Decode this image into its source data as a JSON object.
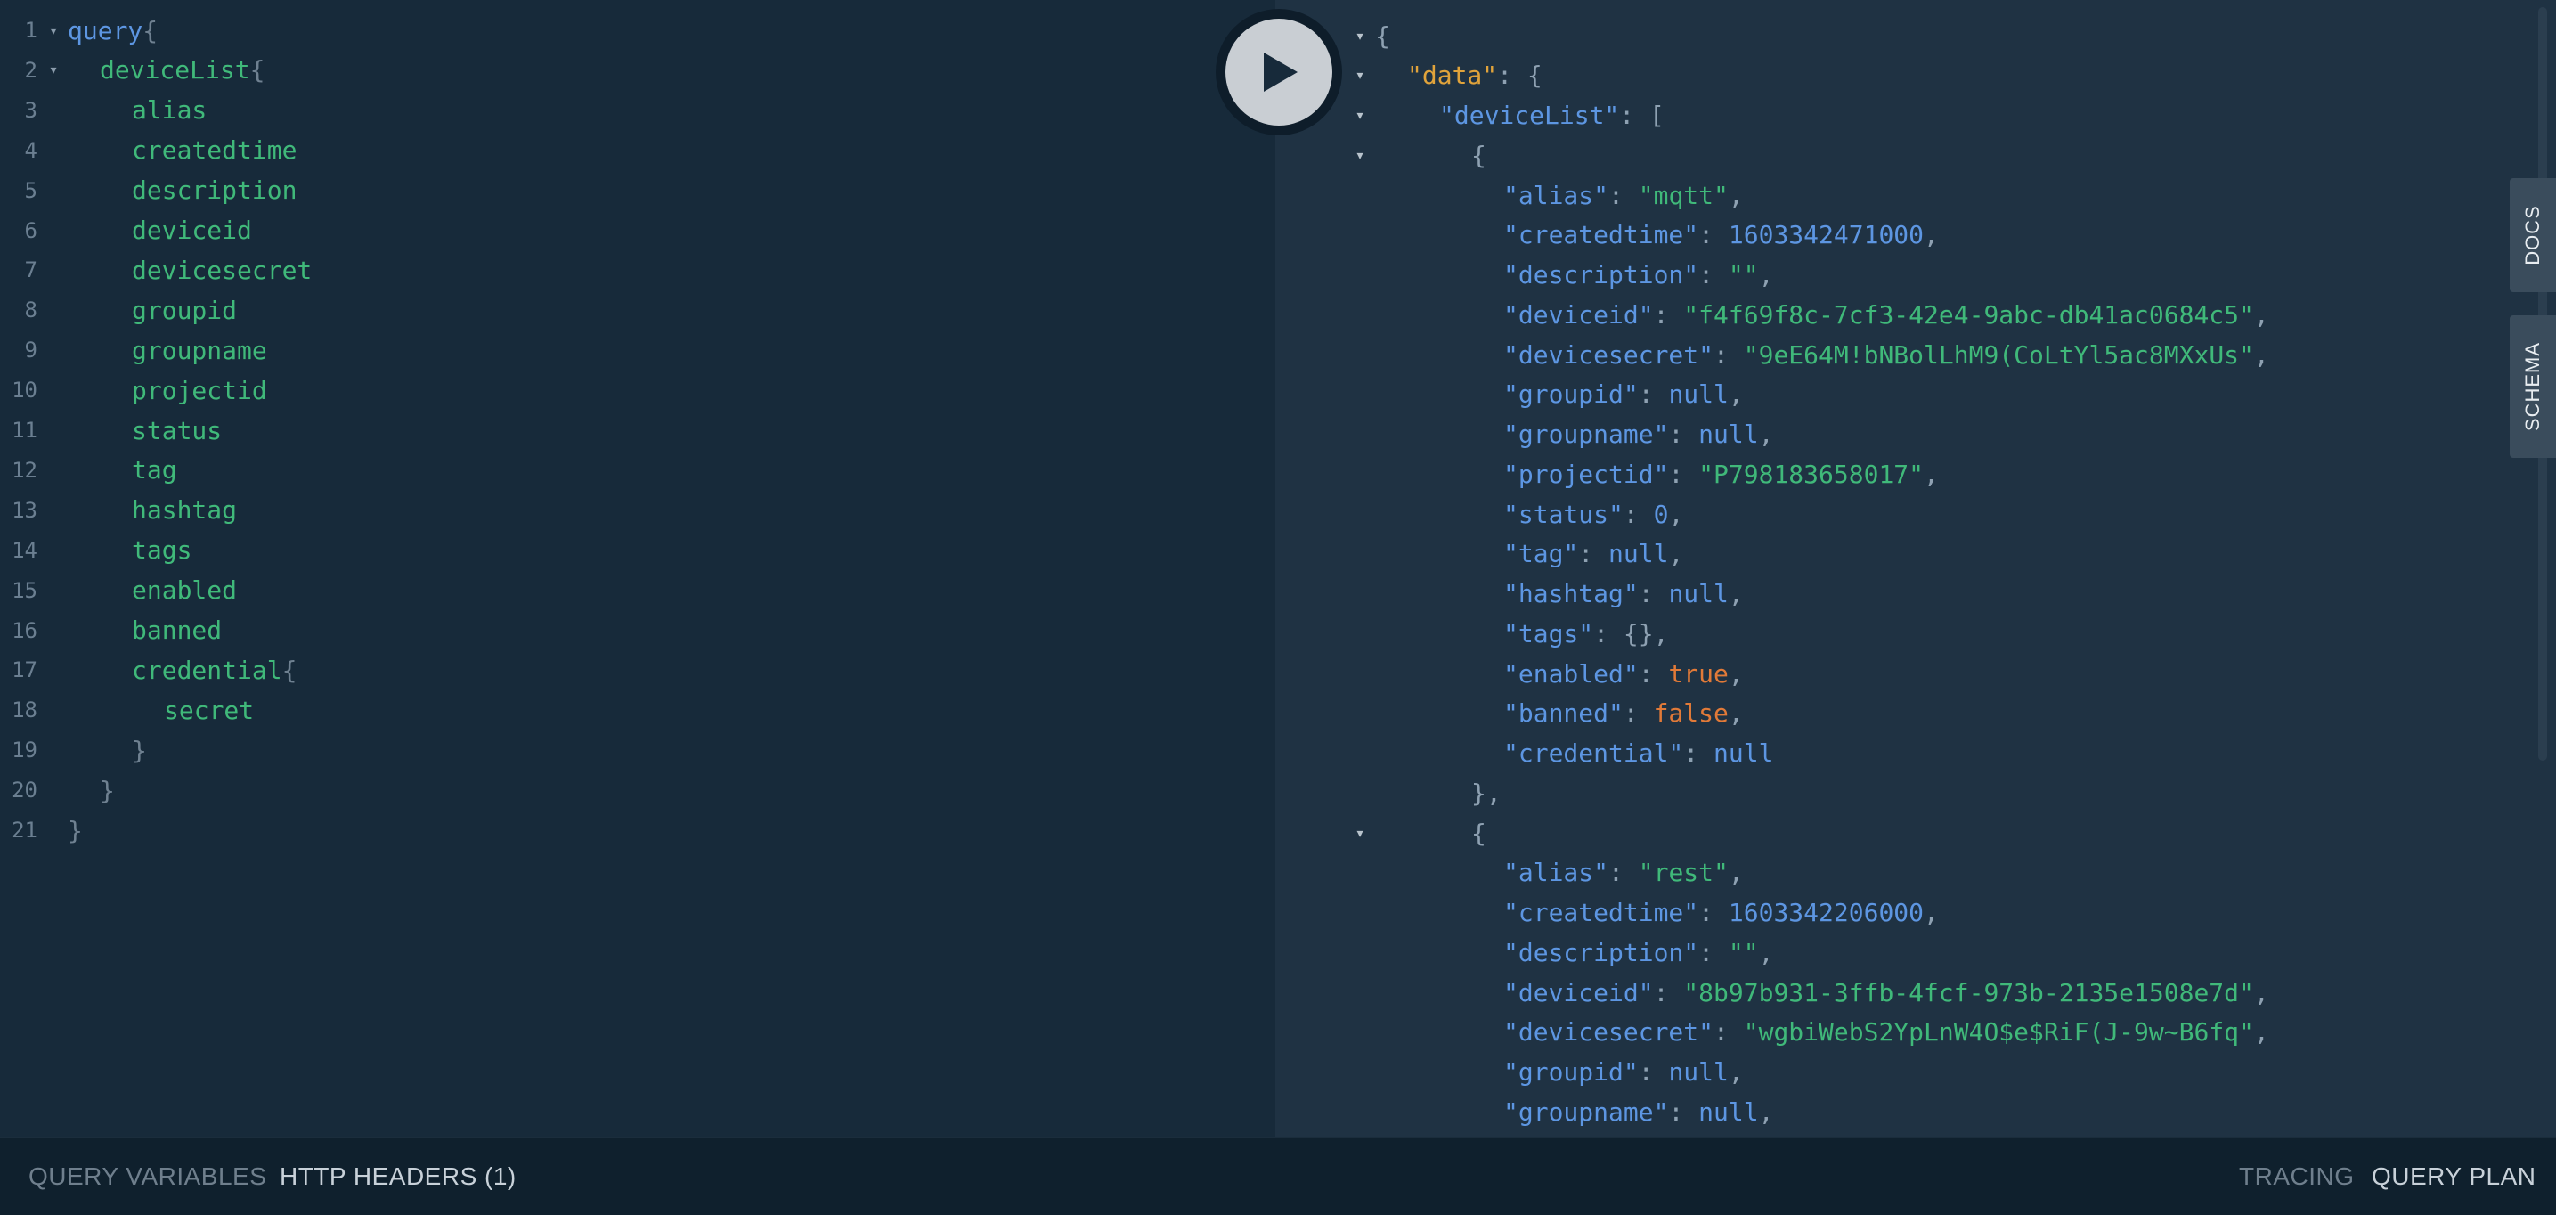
{
  "editor": {
    "lines": [
      {
        "num": "1",
        "fold": "▾",
        "indent": 0,
        "text": "query",
        "cls": "kw",
        "suffix": "{"
      },
      {
        "num": "2",
        "fold": "▾",
        "indent": 1,
        "text": "deviceList",
        "cls": "fld",
        "suffix": "{"
      },
      {
        "num": "3",
        "fold": "",
        "indent": 2,
        "text": "alias",
        "cls": "fld",
        "suffix": ""
      },
      {
        "num": "4",
        "fold": "",
        "indent": 2,
        "text": "createdtime",
        "cls": "fld",
        "suffix": ""
      },
      {
        "num": "5",
        "fold": "",
        "indent": 2,
        "text": "description",
        "cls": "fld",
        "suffix": ""
      },
      {
        "num": "6",
        "fold": "",
        "indent": 2,
        "text": "deviceid",
        "cls": "fld",
        "suffix": ""
      },
      {
        "num": "7",
        "fold": "",
        "indent": 2,
        "text": "devicesecret",
        "cls": "fld",
        "suffix": ""
      },
      {
        "num": "8",
        "fold": "",
        "indent": 2,
        "text": "groupid",
        "cls": "fld",
        "suffix": ""
      },
      {
        "num": "9",
        "fold": "",
        "indent": 2,
        "text": "groupname",
        "cls": "fld",
        "suffix": ""
      },
      {
        "num": "10",
        "fold": "",
        "indent": 2,
        "text": "projectid",
        "cls": "fld",
        "suffix": ""
      },
      {
        "num": "11",
        "fold": "",
        "indent": 2,
        "text": "status",
        "cls": "fld",
        "suffix": ""
      },
      {
        "num": "12",
        "fold": "",
        "indent": 2,
        "text": "tag",
        "cls": "fld",
        "suffix": ""
      },
      {
        "num": "13",
        "fold": "",
        "indent": 2,
        "text": "hashtag",
        "cls": "fld",
        "suffix": ""
      },
      {
        "num": "14",
        "fold": "",
        "indent": 2,
        "text": "tags",
        "cls": "fld",
        "suffix": ""
      },
      {
        "num": "15",
        "fold": "",
        "indent": 2,
        "text": "enabled",
        "cls": "fld",
        "suffix": ""
      },
      {
        "num": "16",
        "fold": "",
        "indent": 2,
        "text": "banned",
        "cls": "fld",
        "suffix": ""
      },
      {
        "num": "17",
        "fold": "",
        "indent": 2,
        "text": "credential",
        "cls": "fld",
        "suffix": "{"
      },
      {
        "num": "18",
        "fold": "",
        "indent": 3,
        "text": "secret",
        "cls": "fld",
        "suffix": ""
      },
      {
        "num": "19",
        "fold": "",
        "indent": 2,
        "text": "",
        "cls": "br",
        "suffix": "}"
      },
      {
        "num": "20",
        "fold": "",
        "indent": 1,
        "text": "",
        "cls": "br",
        "suffix": "}"
      },
      {
        "num": "21",
        "fold": "",
        "indent": 0,
        "text": "",
        "cls": "br",
        "suffix": "}"
      }
    ]
  },
  "play_button_label": "Run query",
  "result": {
    "lines": [
      {
        "fold": "▾",
        "indent": 0,
        "parts": [
          [
            "p",
            "{"
          ]
        ]
      },
      {
        "fold": "▾",
        "indent": 1,
        "parts": [
          [
            "k-data",
            "\"data\""
          ],
          [
            "p",
            ": {"
          ]
        ]
      },
      {
        "fold": "▾",
        "indent": 2,
        "parts": [
          [
            "k",
            "\"deviceList\""
          ],
          [
            "p",
            ": ["
          ]
        ]
      },
      {
        "fold": "▾",
        "indent": 3,
        "parts": [
          [
            "p",
            "{"
          ]
        ]
      },
      {
        "fold": "",
        "indent": 4,
        "parts": [
          [
            "k",
            "\"alias\""
          ],
          [
            "p",
            ": "
          ],
          [
            "s",
            "\"mqtt\""
          ],
          [
            "p",
            ","
          ]
        ]
      },
      {
        "fold": "",
        "indent": 4,
        "parts": [
          [
            "k",
            "\"createdtime\""
          ],
          [
            "p",
            ": "
          ],
          [
            "n",
            "1603342471000"
          ],
          [
            "p",
            ","
          ]
        ]
      },
      {
        "fold": "",
        "indent": 4,
        "parts": [
          [
            "k",
            "\"description\""
          ],
          [
            "p",
            ": "
          ],
          [
            "s",
            "\"\""
          ],
          [
            "p",
            ","
          ]
        ]
      },
      {
        "fold": "",
        "indent": 4,
        "parts": [
          [
            "k",
            "\"deviceid\""
          ],
          [
            "p",
            ": "
          ],
          [
            "s",
            "\"f4f69f8c-7cf3-42e4-9abc-db41ac0684c5\""
          ],
          [
            "p",
            ","
          ]
        ]
      },
      {
        "fold": "",
        "indent": 4,
        "parts": [
          [
            "k",
            "\"devicesecret\""
          ],
          [
            "p",
            ": "
          ],
          [
            "s",
            "\"9eE64M!bNBolLhM9(CoLtYl5ac8MXxUs\""
          ],
          [
            "p",
            ","
          ]
        ]
      },
      {
        "fold": "",
        "indent": 4,
        "parts": [
          [
            "k",
            "\"groupid\""
          ],
          [
            "p",
            ": "
          ],
          [
            "nul",
            "null"
          ],
          [
            "p",
            ","
          ]
        ]
      },
      {
        "fold": "",
        "indent": 4,
        "parts": [
          [
            "k",
            "\"groupname\""
          ],
          [
            "p",
            ": "
          ],
          [
            "nul",
            "null"
          ],
          [
            "p",
            ","
          ]
        ]
      },
      {
        "fold": "",
        "indent": 4,
        "parts": [
          [
            "k",
            "\"projectid\""
          ],
          [
            "p",
            ": "
          ],
          [
            "s",
            "\"P798183658017\""
          ],
          [
            "p",
            ","
          ]
        ]
      },
      {
        "fold": "",
        "indent": 4,
        "parts": [
          [
            "k",
            "\"status\""
          ],
          [
            "p",
            ": "
          ],
          [
            "n",
            "0"
          ],
          [
            "p",
            ","
          ]
        ]
      },
      {
        "fold": "",
        "indent": 4,
        "parts": [
          [
            "k",
            "\"tag\""
          ],
          [
            "p",
            ": "
          ],
          [
            "nul",
            "null"
          ],
          [
            "p",
            ","
          ]
        ]
      },
      {
        "fold": "",
        "indent": 4,
        "parts": [
          [
            "k",
            "\"hashtag\""
          ],
          [
            "p",
            ": "
          ],
          [
            "nul",
            "null"
          ],
          [
            "p",
            ","
          ]
        ]
      },
      {
        "fold": "",
        "indent": 4,
        "parts": [
          [
            "k",
            "\"tags\""
          ],
          [
            "p",
            ": {},"
          ]
        ]
      },
      {
        "fold": "",
        "indent": 4,
        "parts": [
          [
            "k",
            "\"enabled\""
          ],
          [
            "p",
            ": "
          ],
          [
            "bool",
            "true"
          ],
          [
            "p",
            ","
          ]
        ]
      },
      {
        "fold": "",
        "indent": 4,
        "parts": [
          [
            "k",
            "\"banned\""
          ],
          [
            "p",
            ": "
          ],
          [
            "bool",
            "false"
          ],
          [
            "p",
            ","
          ]
        ]
      },
      {
        "fold": "",
        "indent": 4,
        "parts": [
          [
            "k",
            "\"credential\""
          ],
          [
            "p",
            ": "
          ],
          [
            "nul",
            "null"
          ]
        ]
      },
      {
        "fold": "",
        "indent": 3,
        "parts": [
          [
            "p",
            "},"
          ]
        ]
      },
      {
        "fold": "▾",
        "indent": 3,
        "parts": [
          [
            "p",
            "{"
          ]
        ]
      },
      {
        "fold": "",
        "indent": 4,
        "parts": [
          [
            "k",
            "\"alias\""
          ],
          [
            "p",
            ": "
          ],
          [
            "s",
            "\"rest\""
          ],
          [
            "p",
            ","
          ]
        ]
      },
      {
        "fold": "",
        "indent": 4,
        "parts": [
          [
            "k",
            "\"createdtime\""
          ],
          [
            "p",
            ": "
          ],
          [
            "n",
            "1603342206000"
          ],
          [
            "p",
            ","
          ]
        ]
      },
      {
        "fold": "",
        "indent": 4,
        "parts": [
          [
            "k",
            "\"description\""
          ],
          [
            "p",
            ": "
          ],
          [
            "s",
            "\"\""
          ],
          [
            "p",
            ","
          ]
        ]
      },
      {
        "fold": "",
        "indent": 4,
        "parts": [
          [
            "k",
            "\"deviceid\""
          ],
          [
            "p",
            ": "
          ],
          [
            "s",
            "\"8b97b931-3ffb-4fcf-973b-2135e1508e7d\""
          ],
          [
            "p",
            ","
          ]
        ]
      },
      {
        "fold": "",
        "indent": 4,
        "parts": [
          [
            "k",
            "\"devicesecret\""
          ],
          [
            "p",
            ": "
          ],
          [
            "s",
            "\"wgbiWebS2YpLnW4O$e$RiF(J-9w~B6fq\""
          ],
          [
            "p",
            ","
          ]
        ]
      },
      {
        "fold": "",
        "indent": 4,
        "parts": [
          [
            "k",
            "\"groupid\""
          ],
          [
            "p",
            ": "
          ],
          [
            "nul",
            "null"
          ],
          [
            "p",
            ","
          ]
        ]
      },
      {
        "fold": "",
        "indent": 4,
        "parts": [
          [
            "k",
            "\"groupname\""
          ],
          [
            "p",
            ": "
          ],
          [
            "nul",
            "null"
          ],
          [
            "p",
            ","
          ]
        ]
      }
    ]
  },
  "side_tabs": {
    "docs": "DOCS",
    "schema": "SCHEMA"
  },
  "bottom_bar": {
    "query_variables": "QUERY VARIABLES",
    "http_headers": "HTTP HEADERS (1)",
    "tracing": "TRACING",
    "query_plan": "QUERY PLAN"
  },
  "colors": {
    "editor_bg": "#172a3a",
    "result_bg": "#1f3243",
    "keyword": "#5d96e2",
    "field": "#40b97a",
    "data_key": "#e0a33b",
    "boolean": "#e27a38"
  }
}
